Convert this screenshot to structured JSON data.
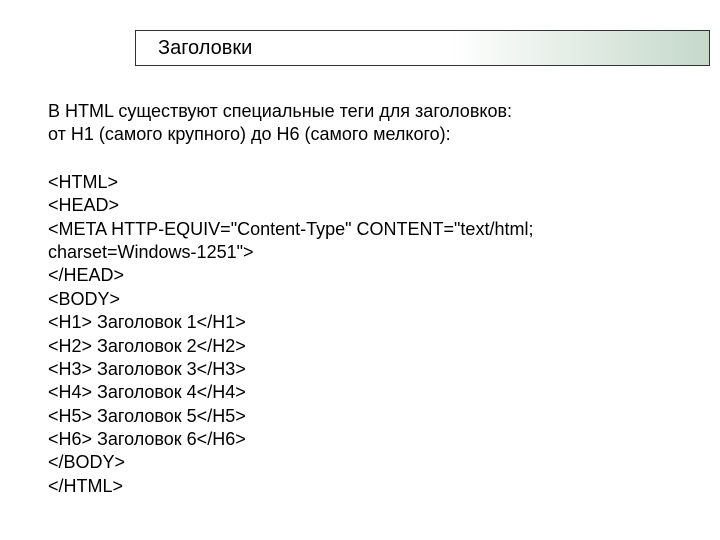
{
  "title": "Заголовки",
  "intro_line1": "В HTML существуют специальные теги для заголовков:",
  "intro_line2": "от Н1 (самого крупного) до Н6 (самого мелкого):",
  "code": [
    "<HTML>",
    "<HEAD>",
    "<META HTTP-EQUIV=\"Content-Type\" CONTENT=\"text/html;",
    "charset=Windows-1251\">",
    "</HEAD>",
    "<BODY>",
    "<H1> Заголовок 1</H1>",
    "<H2> Заголовок 2</H2>",
    "<H3> Заголовок 3</H3>",
    "<H4> Заголовок 4</H4>",
    "<H5> Заголовок 5</H5>",
    "<H6> Заголовок 6</H6>",
    "</BODY>",
    "</HTML>"
  ]
}
